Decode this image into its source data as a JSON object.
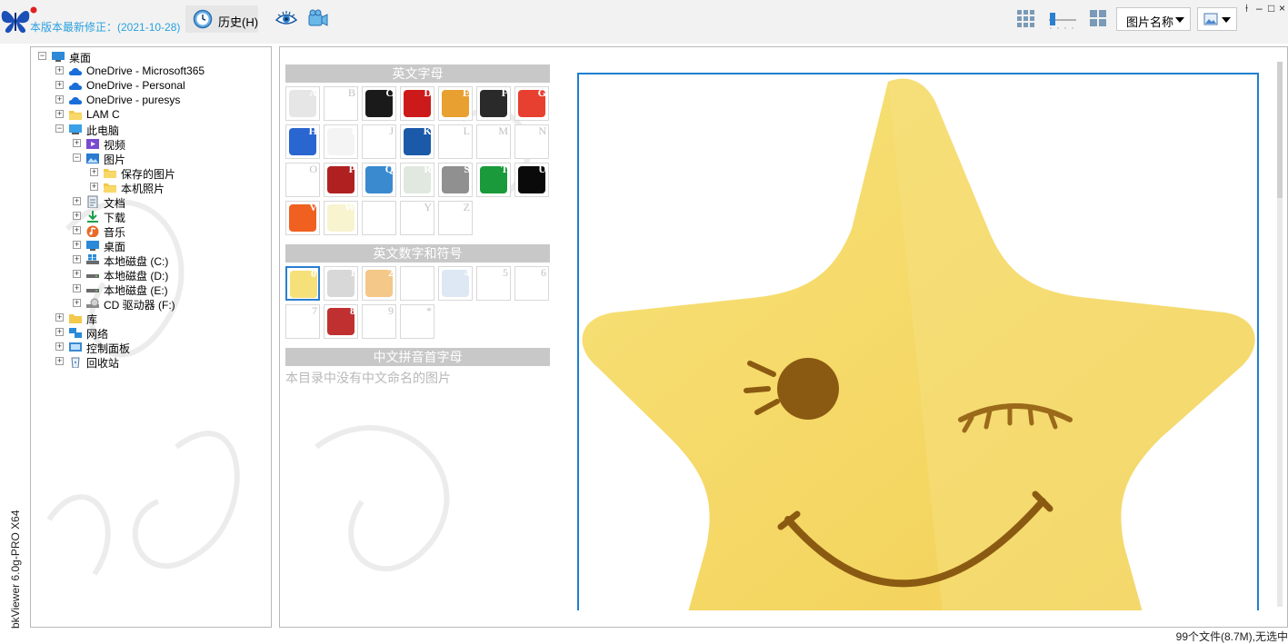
{
  "app": {
    "version_note": "本版本最新修正：(2021-10-28)",
    "vertical_title": "bkViewer 6.0g-PRO X64"
  },
  "toolbar": {
    "history_label": "历史(H)",
    "sort_label": "图片名称",
    "icons": [
      "butterfly-logo",
      "history-clock-icon",
      "eye-icon",
      "camera-icon",
      "large-grid-icon",
      "zoom-slider",
      "small-grid-icon",
      "image-icon"
    ]
  },
  "window_controls": [
    "⌁",
    "–",
    "□",
    "×"
  ],
  "tree": {
    "items": [
      {
        "label": "桌面",
        "level": 0,
        "expanded": true,
        "icon": "desktop-icon"
      },
      {
        "label": "OneDrive - Microsoft365",
        "level": 1,
        "expanded": false,
        "icon": "cloud-icon"
      },
      {
        "label": "OneDrive - Personal",
        "level": 1,
        "expanded": false,
        "icon": "cloud-icon"
      },
      {
        "label": "OneDrive - puresys",
        "level": 1,
        "expanded": false,
        "icon": "cloud-icon"
      },
      {
        "label": "LAM C",
        "level": 1,
        "expanded": false,
        "icon": "folder-icon"
      },
      {
        "label": "此电脑",
        "level": 1,
        "expanded": true,
        "icon": "computer-icon"
      },
      {
        "label": "视频",
        "level": 2,
        "expanded": false,
        "icon": "video-icon"
      },
      {
        "label": "图片",
        "level": 2,
        "expanded": true,
        "icon": "pictures-icon"
      },
      {
        "label": "保存的图片",
        "level": 3,
        "expanded": false,
        "icon": "folder-icon"
      },
      {
        "label": "本机照片",
        "level": 3,
        "expanded": false,
        "icon": "folder-icon"
      },
      {
        "label": "文档",
        "level": 2,
        "expanded": false,
        "icon": "document-icon"
      },
      {
        "label": "下载",
        "level": 2,
        "expanded": false,
        "icon": "download-icon"
      },
      {
        "label": "音乐",
        "level": 2,
        "expanded": false,
        "icon": "music-icon"
      },
      {
        "label": "桌面",
        "level": 2,
        "expanded": false,
        "icon": "desktop-icon"
      },
      {
        "label": "本地磁盘 (C:)",
        "level": 2,
        "expanded": false,
        "icon": "drive-c-icon"
      },
      {
        "label": "本地磁盘 (D:)",
        "level": 2,
        "expanded": false,
        "icon": "drive-icon"
      },
      {
        "label": "本地磁盘 (E:)",
        "level": 2,
        "expanded": false,
        "icon": "drive-icon"
      },
      {
        "label": "CD 驱动器 (F:)",
        "level": 2,
        "expanded": false,
        "icon": "cd-drive-icon"
      },
      {
        "label": "库",
        "level": 1,
        "expanded": false,
        "icon": "library-icon"
      },
      {
        "label": "网络",
        "level": 1,
        "expanded": false,
        "icon": "network-icon"
      },
      {
        "label": "控制面板",
        "level": 1,
        "expanded": false,
        "icon": "control-panel-icon"
      },
      {
        "label": "回收站",
        "level": 1,
        "expanded": false,
        "icon": "recycle-bin-icon"
      }
    ]
  },
  "sections": {
    "letters_header": "英文字母",
    "digits_header": "英文数字和符号",
    "pinyin_header": "中文拼音首字母",
    "pinyin_empty": "本目录中没有中文命名的图片"
  },
  "letter_thumbs": [
    {
      "letter": "A",
      "has": true,
      "color": "#e6e6e6",
      "icon": "flash-player-icon"
    },
    {
      "letter": "B",
      "has": false
    },
    {
      "letter": "C",
      "has": true,
      "color": "#1a1a1a",
      "icon": "dark-app-icon"
    },
    {
      "letter": "D",
      "has": true,
      "color": "#cc1a1a",
      "icon": "red-gear-icon"
    },
    {
      "letter": "E",
      "has": true,
      "color": "#e8a030",
      "icon": "orange-app-icon"
    },
    {
      "letter": "F",
      "has": true,
      "color": "#2a2a2a",
      "icon": "mascot-icon"
    },
    {
      "letter": "G",
      "has": true,
      "color": "#e84030",
      "icon": "player-icon"
    },
    {
      "letter": "H",
      "has": true,
      "color": "#2a66d0",
      "icon": "voice-icon"
    },
    {
      "letter": "I",
      "has": true,
      "color": "#f4f4f4",
      "icon": "screenshot-icon"
    },
    {
      "letter": "J",
      "has": false
    },
    {
      "letter": "K",
      "has": true,
      "color": "#1a5aa8",
      "icon": "office-icon"
    },
    {
      "letter": "L",
      "has": false
    },
    {
      "letter": "M",
      "has": false
    },
    {
      "letter": "N",
      "has": false
    },
    {
      "letter": "O",
      "has": false
    },
    {
      "letter": "P",
      "has": true,
      "color": "#b02020",
      "icon": "pdf-icon"
    },
    {
      "letter": "Q",
      "has": true,
      "color": "#3a8ad0",
      "icon": "qbittorrent-icon"
    },
    {
      "letter": "R",
      "has": true,
      "color": "#e0e8e0",
      "icon": "window-icon"
    },
    {
      "letter": "S",
      "has": true,
      "color": "#909090",
      "icon": "ventoy-icon"
    },
    {
      "letter": "T",
      "has": true,
      "color": "#1a9a3a",
      "icon": "green-app-icon"
    },
    {
      "letter": "U",
      "has": true,
      "color": "#0a0a0a",
      "icon": "tool-icon"
    },
    {
      "letter": "V",
      "has": true,
      "color": "#f06020",
      "icon": "colorful-icon"
    },
    {
      "letter": "W",
      "has": true,
      "color": "#f8f4d0",
      "icon": "small-image-icon"
    },
    {
      "letter": "X",
      "has": true,
      "color": "#ffffff",
      "icon": "bug-icon"
    },
    {
      "letter": "Y",
      "has": false
    },
    {
      "letter": "Z",
      "has": false
    }
  ],
  "digit_thumbs": [
    {
      "letter": "0",
      "has": true,
      "color": "#f6e07a",
      "icon": "star-face-icon",
      "selected": true
    },
    {
      "letter": "1",
      "has": true,
      "color": "#d8d8d8",
      "icon": "table-icon"
    },
    {
      "letter": "2",
      "has": true,
      "color": "#f4c888",
      "icon": "chart-icon"
    },
    {
      "letter": "3",
      "has": true,
      "color": "#ffffff",
      "icon": "ring-icon"
    },
    {
      "letter": "4",
      "has": true,
      "color": "#dde8f4",
      "icon": "doc-icon"
    },
    {
      "letter": "5",
      "has": false
    },
    {
      "letter": "6",
      "has": false
    },
    {
      "letter": "7",
      "has": false
    },
    {
      "letter": "8",
      "has": true,
      "color": "#c03030",
      "icon": "qr-icon"
    },
    {
      "letter": "9",
      "has": false
    },
    {
      "letter": "*",
      "has": false
    }
  ],
  "status": {
    "text": "99个文件(8.7M),无选中"
  },
  "colors": {
    "accent": "#1f7fd0",
    "version_text": "#2aa0e0",
    "header_gray": "#c8c8c8"
  }
}
